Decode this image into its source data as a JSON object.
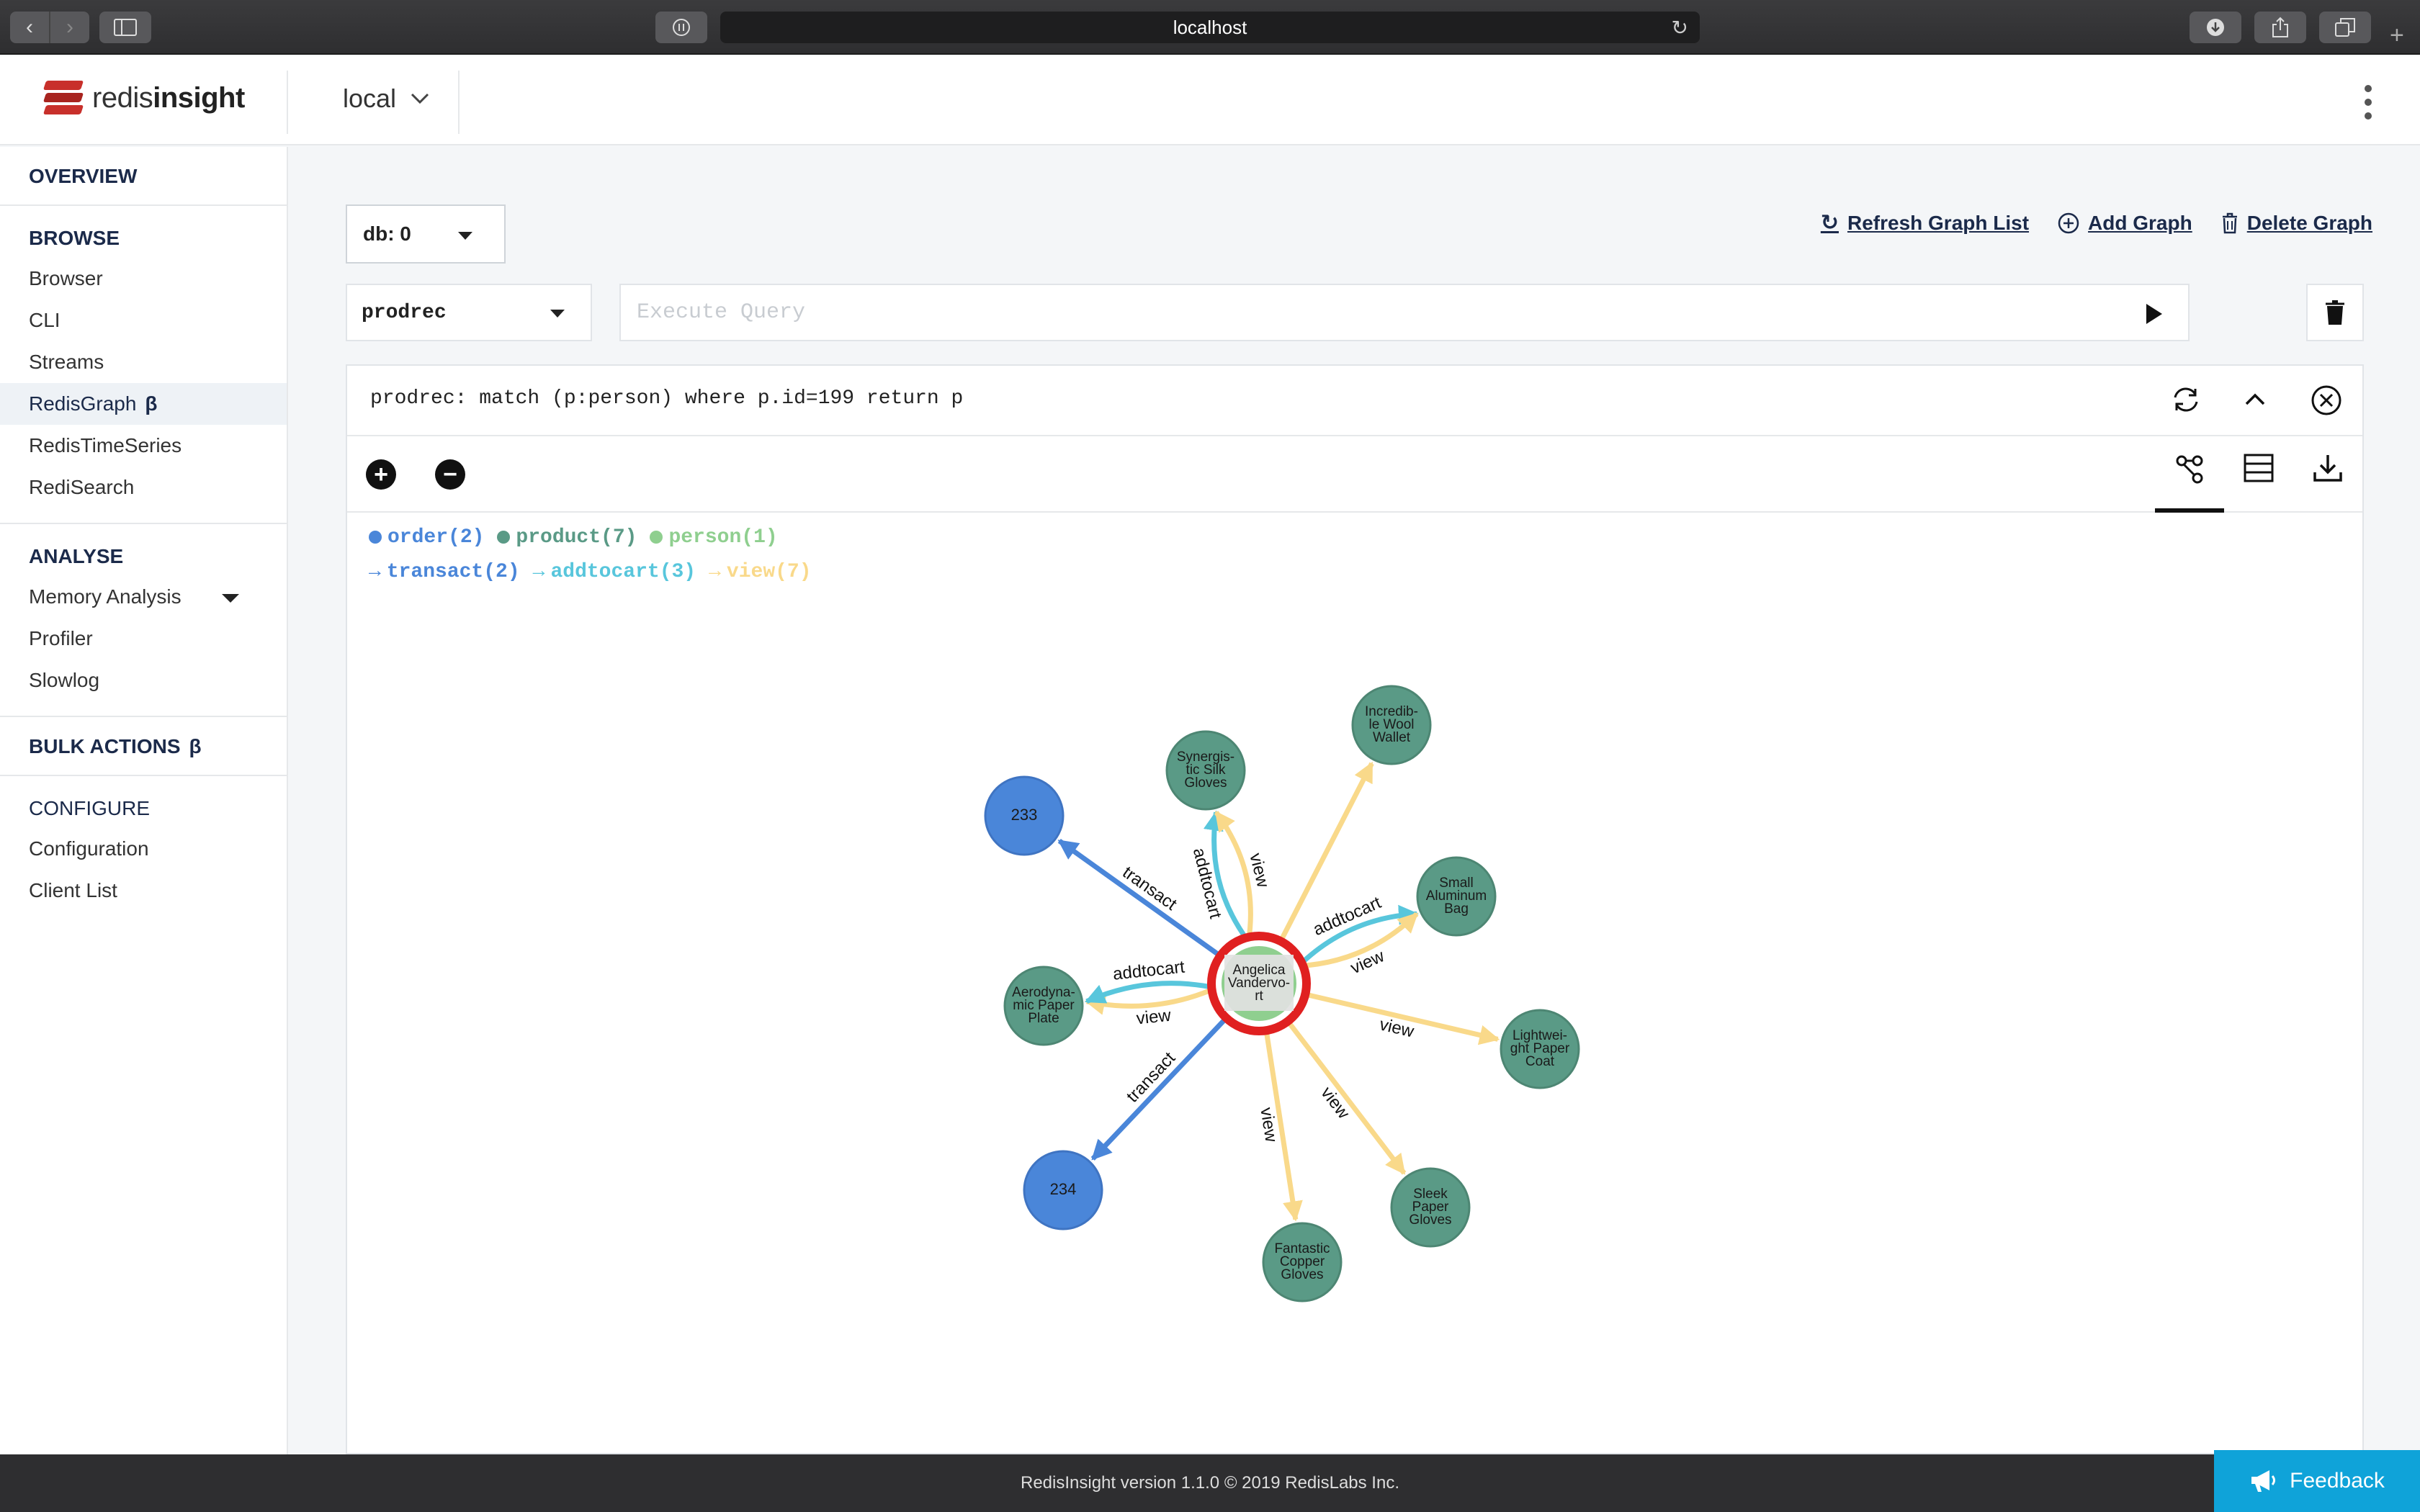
{
  "browser": {
    "url": "localhost",
    "back_icon": "chevron-left-icon",
    "forward_icon": "chevron-right-icon"
  },
  "header": {
    "logo_text_light": "redis",
    "logo_text_bold": "insight",
    "instance": "local"
  },
  "sidebar": {
    "overview": "OVERVIEW",
    "browse": {
      "title": "BROWSE",
      "items": [
        "Browser",
        "CLI",
        "Streams",
        "RedisGraph",
        "RedisTimeSeries",
        "RediSearch"
      ],
      "active": "RedisGraph",
      "beta": "β"
    },
    "analyse": {
      "title": "ANALYSE",
      "items": [
        "Memory Analysis",
        "Profiler",
        "Slowlog"
      ]
    },
    "bulk_actions": "BULK ACTIONS",
    "bulk_beta": "β",
    "configure": {
      "title": "CONFIGURE",
      "items": [
        "Configuration",
        "Client List"
      ]
    }
  },
  "main": {
    "db_select": "db: 0",
    "actions": {
      "refresh": "Refresh Graph List",
      "add": "Add Graph",
      "delete": "Delete Graph"
    },
    "graph_select": "prodrec",
    "query_placeholder": "Execute Query",
    "result": {
      "query": "prodrec: match (p:person) where p.id=199 return p"
    },
    "legend": {
      "labels": [
        {
          "text": "order(2)",
          "color": "#4a86d9"
        },
        {
          "text": "product(7)",
          "color": "#5a9a86"
        },
        {
          "text": "person(1)",
          "color": "#8fcf8f"
        }
      ],
      "relationships": [
        {
          "text": "transact(2)",
          "color": "#4a86d9"
        },
        {
          "text": "addtocart(3)",
          "color": "#58c6dc"
        },
        {
          "text": "view(7)",
          "color": "#f9d98a"
        }
      ]
    }
  },
  "graph": {
    "center": {
      "lines": [
        "Angelica",
        "Vandervo-",
        "rt"
      ]
    },
    "nodes": [
      {
        "id": "n233",
        "lines": [
          "233"
        ],
        "kind": "order"
      },
      {
        "id": "n234",
        "lines": [
          "234"
        ],
        "kind": "order"
      },
      {
        "id": "nsyn",
        "lines": [
          "Synergis-",
          "tic Silk",
          "Gloves"
        ],
        "kind": "product"
      },
      {
        "id": "ninc",
        "lines": [
          "Incredib-",
          "le Wool",
          "Wallet"
        ],
        "kind": "product"
      },
      {
        "id": "nsma",
        "lines": [
          "Small",
          "Aluminum",
          "Bag"
        ],
        "kind": "product"
      },
      {
        "id": "naer",
        "lines": [
          "Aerodyna-",
          "mic Paper",
          "Plate"
        ],
        "kind": "product"
      },
      {
        "id": "nlig",
        "lines": [
          "Lightwei-",
          "ght Paper",
          "Coat"
        ],
        "kind": "product"
      },
      {
        "id": "nsle",
        "lines": [
          "Sleek",
          "Paper",
          "Gloves"
        ],
        "kind": "product"
      },
      {
        "id": "nfan",
        "lines": [
          "Fantastic",
          "Copper",
          "Gloves"
        ],
        "kind": "product"
      }
    ],
    "edges": [
      {
        "to": "n233",
        "label": "transact",
        "type": "transact"
      },
      {
        "to": "n234",
        "label": "transact",
        "type": "transact"
      },
      {
        "to": "nsyn",
        "label": "addtocart",
        "type": "addtocart"
      },
      {
        "to": "nsyn",
        "label": "view",
        "type": "view"
      },
      {
        "to": "ninc",
        "label": "",
        "type": "view"
      },
      {
        "to": "nsma",
        "label": "addtocart",
        "type": "addtocart"
      },
      {
        "to": "nsma",
        "label": "view",
        "type": "view"
      },
      {
        "to": "naer",
        "label": "view",
        "type": "view"
      },
      {
        "to": "naer",
        "label": "addtocart",
        "type": "addtocart"
      },
      {
        "to": "nlig",
        "label": "view",
        "type": "view"
      },
      {
        "to": "nsle",
        "label": "view",
        "type": "view"
      },
      {
        "to": "nfan",
        "label": "view",
        "type": "view"
      }
    ],
    "colors": {
      "order": "#4a86d9",
      "product": "#5a9a86",
      "person_ring": "#e02020",
      "transact": "#4a86d9",
      "addtocart": "#58c6dc",
      "view": "#f9d98a"
    }
  },
  "footer": {
    "version": "RedisInsight version 1.1.0 © 2019 RedisLabs Inc.",
    "feedback": "Feedback"
  }
}
